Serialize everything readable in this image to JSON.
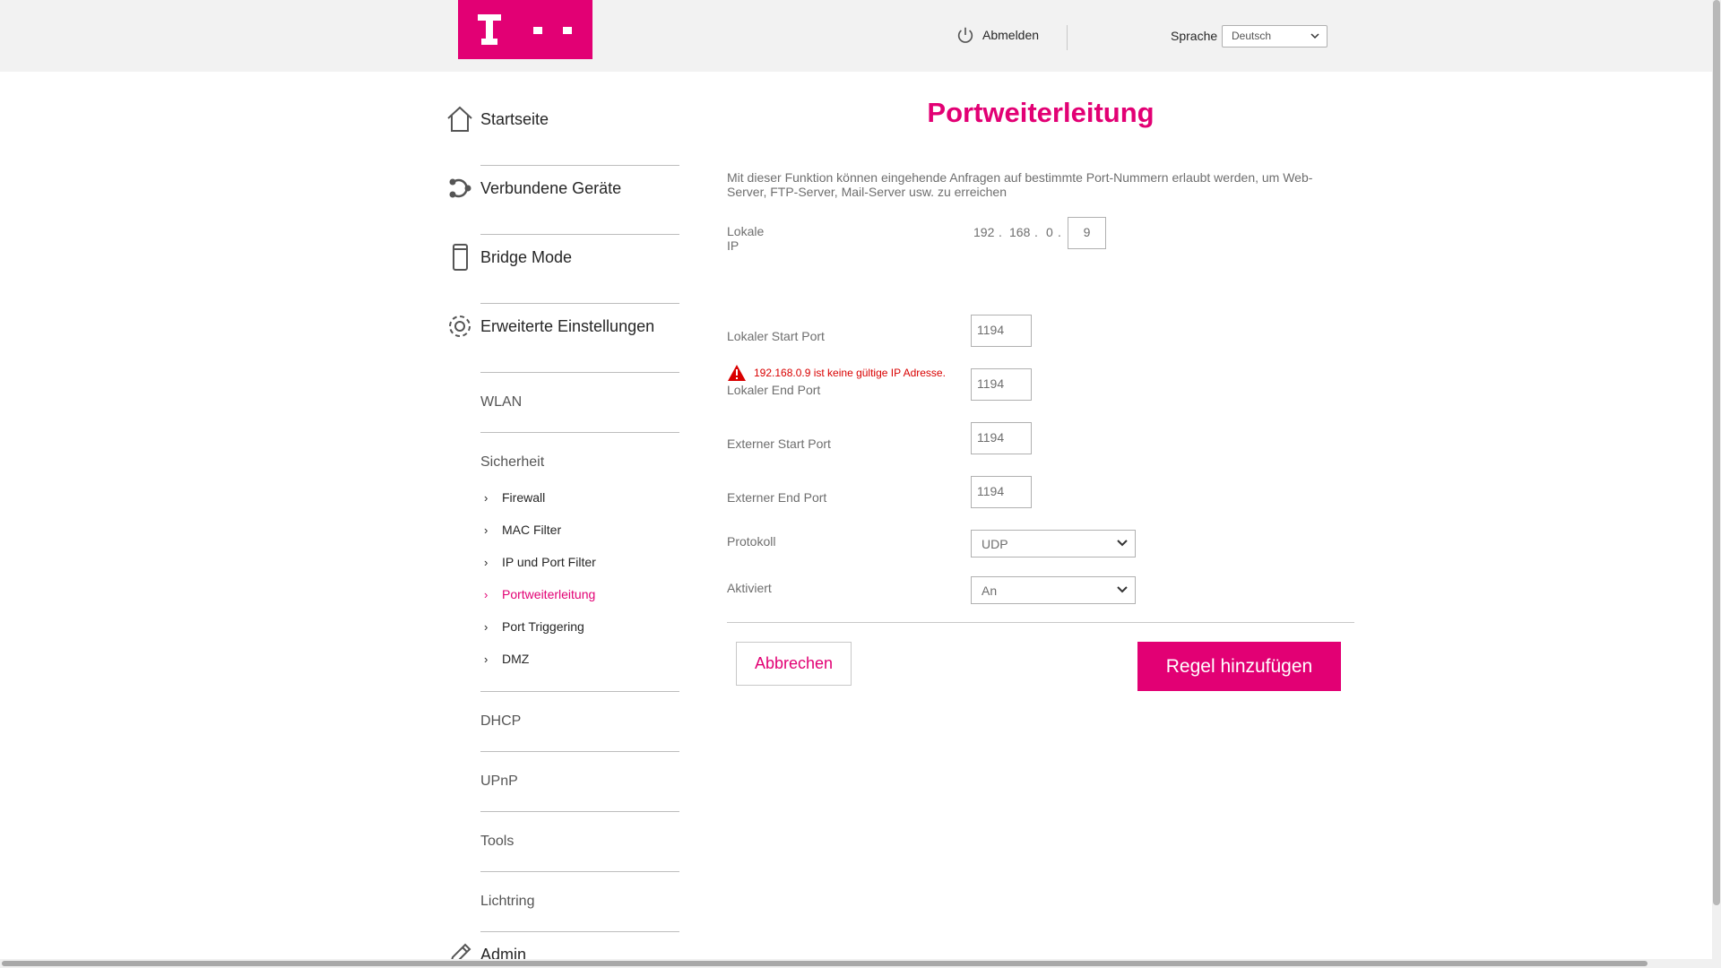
{
  "header": {
    "logout_label": "Abmelden",
    "language_label": "Sprache",
    "language_value": "Deutsch"
  },
  "sidebar": {
    "main_items": [
      {
        "label": "Startseite",
        "icon": "home-icon"
      },
      {
        "label": "Verbundene Geräte",
        "icon": "devices-icon"
      },
      {
        "label": "Bridge Mode",
        "icon": "bridge-icon"
      },
      {
        "label": "Erweiterte Einstellungen",
        "icon": "gear-icon"
      }
    ],
    "sub_wlan": "WLAN",
    "security": {
      "title": "Sicherheit",
      "items": [
        "Firewall",
        "MAC Filter",
        "IP und Port Filter",
        "Portweiterleitung",
        "Port Triggering",
        "DMZ"
      ],
      "active": "Portweiterleitung"
    },
    "sub_items": [
      "DHCP",
      "UPnP",
      "Tools",
      "Lichtring"
    ],
    "admin": {
      "label": "Admin",
      "icon": "pencil-icon"
    }
  },
  "main": {
    "title": "Portweiterleitung",
    "description": "Mit dieser Funktion können eingehende Anfragen auf bestimmte Port-Nummern erlaubt werden, um Web-Server, FTP-Server, Mail-Server usw. zu erreichen",
    "local_ip": {
      "label": "Lokale IP",
      "octet1": "192",
      "octet2": "168",
      "octet3": "0",
      "octet4": "9",
      "sep": "."
    },
    "error_message": "192.168.0.9 ist keine gültige IP Adresse.",
    "fields": {
      "local_start_port": {
        "label": "Lokaler Start Port",
        "value": "1194"
      },
      "local_end_port": {
        "label": "Lokaler End Port",
        "value": "1194"
      },
      "external_start_port": {
        "label": "Externer Start Port",
        "value": "1194"
      },
      "external_end_port": {
        "label": "Externer End Port",
        "value": "1194"
      }
    },
    "protocol": {
      "label": "Protokoll",
      "value": "UDP"
    },
    "enabled": {
      "label": "Aktiviert",
      "value": "An"
    },
    "cancel_label": "Abbrechen",
    "add_rule_label": "Regel hinzufügen"
  },
  "colors": {
    "brand": "#e20074",
    "error": "#d90000"
  }
}
